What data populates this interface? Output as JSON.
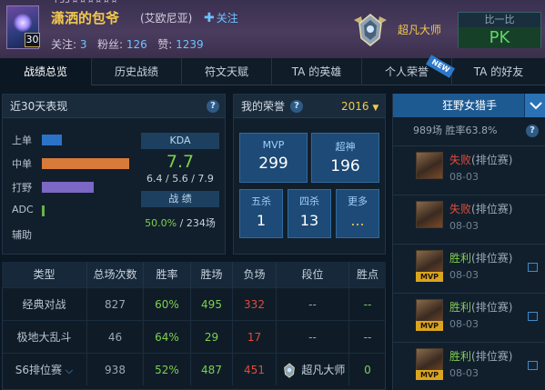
{
  "header": {
    "top_text": "ì 33 ¤ ¤ ¤ ¤ ¤ ¤",
    "level": "30",
    "name": "潇洒的包爷",
    "server": "(艾欧尼亚)",
    "follow_label": "关注",
    "follows_label": "关注:",
    "follows": "3",
    "fans_label": "粉丝:",
    "fans": "126",
    "likes_label": "赞:",
    "likes": "1239",
    "rank_name": "超凡大师",
    "compare_label": "比一比",
    "pk_label": "PK"
  },
  "tabs": [
    {
      "label": "战绩总览"
    },
    {
      "label": "历史战绩"
    },
    {
      "label": "符文天赋"
    },
    {
      "label": "TA 的英雄"
    },
    {
      "label": "个人荣誉"
    },
    {
      "label": "TA 的好友"
    }
  ],
  "new_badge": "NEW",
  "recent": {
    "title": "近30天表现",
    "help": "?",
    "lanes": [
      {
        "label": "上单",
        "value": 0.22,
        "color": "#2a73c8"
      },
      {
        "label": "中单",
        "value": 0.96,
        "color": "#d77a3a"
      },
      {
        "label": "打野",
        "value": 0.57,
        "color": "#7b67c4"
      },
      {
        "label": "ADC",
        "value": 0.03,
        "color": "#6ab04c"
      },
      {
        "label": "辅助",
        "value": 0.0,
        "color": "#6ab04c"
      }
    ],
    "kda_label": "KDA",
    "kda_value": "7.7",
    "kda_detail": "6.4 / 5.6 / 7.9",
    "record_label": "战 绩",
    "winrate": "50.0%",
    "games": "234场"
  },
  "honor": {
    "title": "我的荣誉",
    "help": "?",
    "year": "2016",
    "mvp_label": "MVP",
    "mvp": "299",
    "godlike_label": "超神",
    "godlike": "196",
    "penta_label": "五杀",
    "penta": "1",
    "quadra_label": "四杀",
    "quadra": "13",
    "more_label": "更多",
    "more_value": "..."
  },
  "table": {
    "headers": [
      "类型",
      "总场次数",
      "胜率",
      "胜场",
      "负场",
      "段位",
      "胜点"
    ],
    "rows": [
      {
        "type": "经典对战",
        "total": "827",
        "rate": "60%",
        "wins": "495",
        "losses": "332",
        "tier": "--",
        "lp": "--"
      },
      {
        "type": "极地大乱斗",
        "total": "46",
        "rate": "64%",
        "wins": "29",
        "losses": "17",
        "tier": "--",
        "lp": "--"
      },
      {
        "type": "S6排位赛",
        "total": "938",
        "rate": "52%",
        "wins": "487",
        "losses": "451",
        "tier": "超凡大师",
        "lp": "0"
      }
    ]
  },
  "right": {
    "champion": "狂野女猎手",
    "games": "989场",
    "winrate_label": "胜率63.8%",
    "help": "?",
    "records": [
      {
        "result": "失败",
        "mode": "(排位赛)",
        "date": "08-03",
        "win": false,
        "mvp": ""
      },
      {
        "result": "失败",
        "mode": "(排位赛)",
        "date": "08-03",
        "win": false,
        "mvp": ""
      },
      {
        "result": "胜利",
        "mode": "(排位赛)",
        "date": "08-03",
        "win": true,
        "mvp": "MVP"
      },
      {
        "result": "胜利",
        "mode": "(排位赛)",
        "date": "08-03",
        "win": true,
        "mvp": "MVP"
      },
      {
        "result": "胜利",
        "mode": "(排位赛)",
        "date": "08-03",
        "win": true,
        "mvp": "MVP"
      }
    ]
  },
  "colors": {
    "accent": "#6cc3ff",
    "gold": "#f2c94c",
    "win": "#7fcf4e",
    "loss": "#e34a3a"
  }
}
